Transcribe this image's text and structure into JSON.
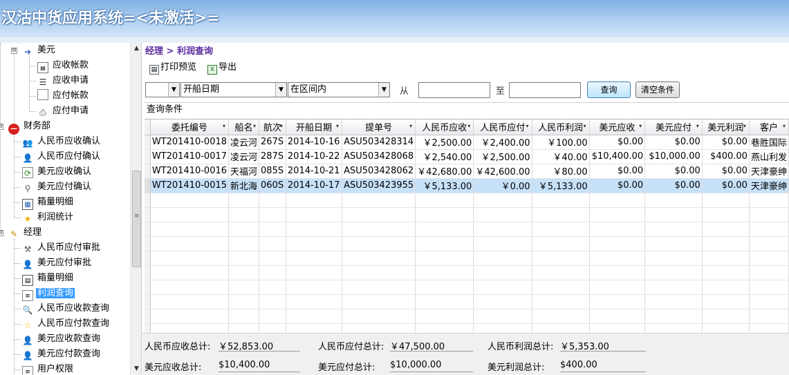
{
  "window": {
    "title": "汉沽中货应用系统=<未激活>="
  },
  "sidebar": {
    "items": [
      {
        "label": "美元"
      },
      {
        "label": "应收帐款"
      },
      {
        "label": "应收申请"
      },
      {
        "label": "应付帐款"
      },
      {
        "label": "应付申请"
      },
      {
        "label": "财务部"
      },
      {
        "label": "人民币应收确认"
      },
      {
        "label": "人民币应付确认"
      },
      {
        "label": "美元应收确认"
      },
      {
        "label": "美元应付确认"
      },
      {
        "label": "箱量明细"
      },
      {
        "label": "利润统计"
      },
      {
        "label": "经理"
      },
      {
        "label": "人民币应付审批"
      },
      {
        "label": "美元应付审批"
      },
      {
        "label": "箱量明细"
      },
      {
        "label": "利润查询"
      },
      {
        "label": "人民币应收款查询"
      },
      {
        "label": "人民币应付款查询"
      },
      {
        "label": "美元应收款查询"
      },
      {
        "label": "美元应付款查询"
      },
      {
        "label": "用户权限"
      }
    ],
    "expanders": {
      "collapse": "⊟",
      "expand": "⊞"
    },
    "scroll": {
      "up": "▲",
      "down": "▼",
      "grip": "≡"
    }
  },
  "main": {
    "breadcrumb": "经理 > 利润查询",
    "toolbar": {
      "print_preview": "打印预览",
      "export": "导出"
    },
    "filter": {
      "field1_value": "",
      "field2_value": "开船日期",
      "field3_value": "在区间内",
      "from_label": "从",
      "to_label": "至",
      "from_value": "",
      "to_value": "",
      "query_button": "查询",
      "clear_button": "清空条件",
      "dropdown_arrow": "▼"
    },
    "conditions_label": "查询条件",
    "grid": {
      "filter_arrow": "▾",
      "columns": [
        "委托编号",
        "船名",
        "航次",
        "开船日期",
        "提单号",
        "人民币应收",
        "人民币应付",
        "人民币利润",
        "美元应收",
        "美元应付",
        "美元利润",
        "客户"
      ],
      "rows": [
        [
          "WT201410-0018",
          "凌云河",
          "267S",
          "2014-10-16",
          "ASU503428314",
          "￥2,500.00",
          "￥2,400.00",
          "￥100.00",
          "$0.00",
          "$0.00",
          "$0.00",
          "巷胜国际"
        ],
        [
          "WT201410-0017",
          "凌云河",
          "287S",
          "2014-10-22",
          "ASU503428068",
          "￥2,540.00",
          "￥2,500.00",
          "￥40.00",
          "$10,400.00",
          "$10,000.00",
          "$400.00",
          "燕山利发"
        ],
        [
          "WT201410-0016",
          "天福河",
          "085S",
          "2014-10-21",
          "ASU503428062",
          "￥42,680.00",
          "￥42,600.00",
          "￥80.00",
          "$0.00",
          "$0.00",
          "$0.00",
          "天津豪绅"
        ],
        [
          "WT201410-0015",
          "新北海",
          "060S",
          "2014-10-17",
          "ASU503423955",
          "￥5,133.00",
          "￥0.00",
          "￥5,133.00",
          "$0.00",
          "$0.00",
          "$0.00",
          "天津豪绅"
        ]
      ],
      "selected_row": 3
    },
    "summary": {
      "rmb_receivable_label": "人民币应收总计:",
      "rmb_receivable_value": "￥52,853.00",
      "rmb_payable_label": "人民币应付总计:",
      "rmb_payable_value": "￥47,500.00",
      "rmb_profit_label": "人民币利润总计:",
      "rmb_profit_value": "￥5,353.00",
      "usd_receivable_label": "美元应收总计:",
      "usd_receivable_value": "$10,400.00",
      "usd_payable_label": "美元应付总计:",
      "usd_payable_value": "$10,000.00",
      "usd_profit_label": "美元利润总计:",
      "usd_profit_value": "$400.00"
    }
  }
}
